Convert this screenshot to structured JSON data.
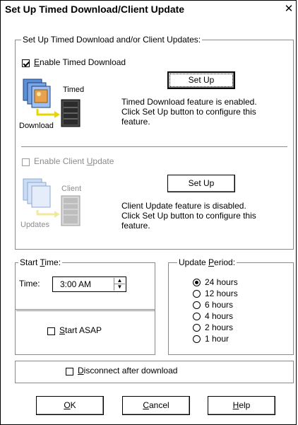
{
  "window": {
    "title": "Set Up Timed Download/Client Update",
    "close_glyph": "✕"
  },
  "setup_group": {
    "legend": "Set Up Timed Download and/or Client Updates:",
    "timed": {
      "checkbox_label": "Enable Timed Download",
      "checked": true,
      "icon_label_top": "Timed",
      "icon_label_bottom": "Download",
      "button_label": "Set Up",
      "description": [
        "Timed Download feature is enabled.",
        "Click Set Up button to configure this",
        "feature."
      ]
    },
    "client": {
      "checkbox_label": "Enable Client Update",
      "checked": false,
      "disabled": true,
      "icon_label_top": "Client",
      "icon_label_bottom": "Updates",
      "button_label": "Set Up",
      "description": [
        "Client Update feature is disabled.",
        "Click Set Up button to configure this",
        "feature."
      ]
    }
  },
  "start_time": {
    "legend": "Start Time:",
    "time_label": "Time:",
    "time_value": "3:00 AM",
    "asap_label": "Start ASAP",
    "asap_checked": false
  },
  "update_period": {
    "legend": "Update Period:",
    "options": [
      "24 hours",
      "12 hours",
      "6 hours",
      "4 hours",
      "2 hours",
      "1 hour"
    ],
    "selected": "24 hours"
  },
  "disconnect": {
    "label": "Disconnect after download",
    "checked": false
  },
  "buttons": {
    "ok": "OK",
    "cancel": "Cancel",
    "help": "Help"
  },
  "colors": {
    "frame_border": "#000000",
    "group_border": "#8a8a8a",
    "disabled_text": "#8c8c8c"
  }
}
